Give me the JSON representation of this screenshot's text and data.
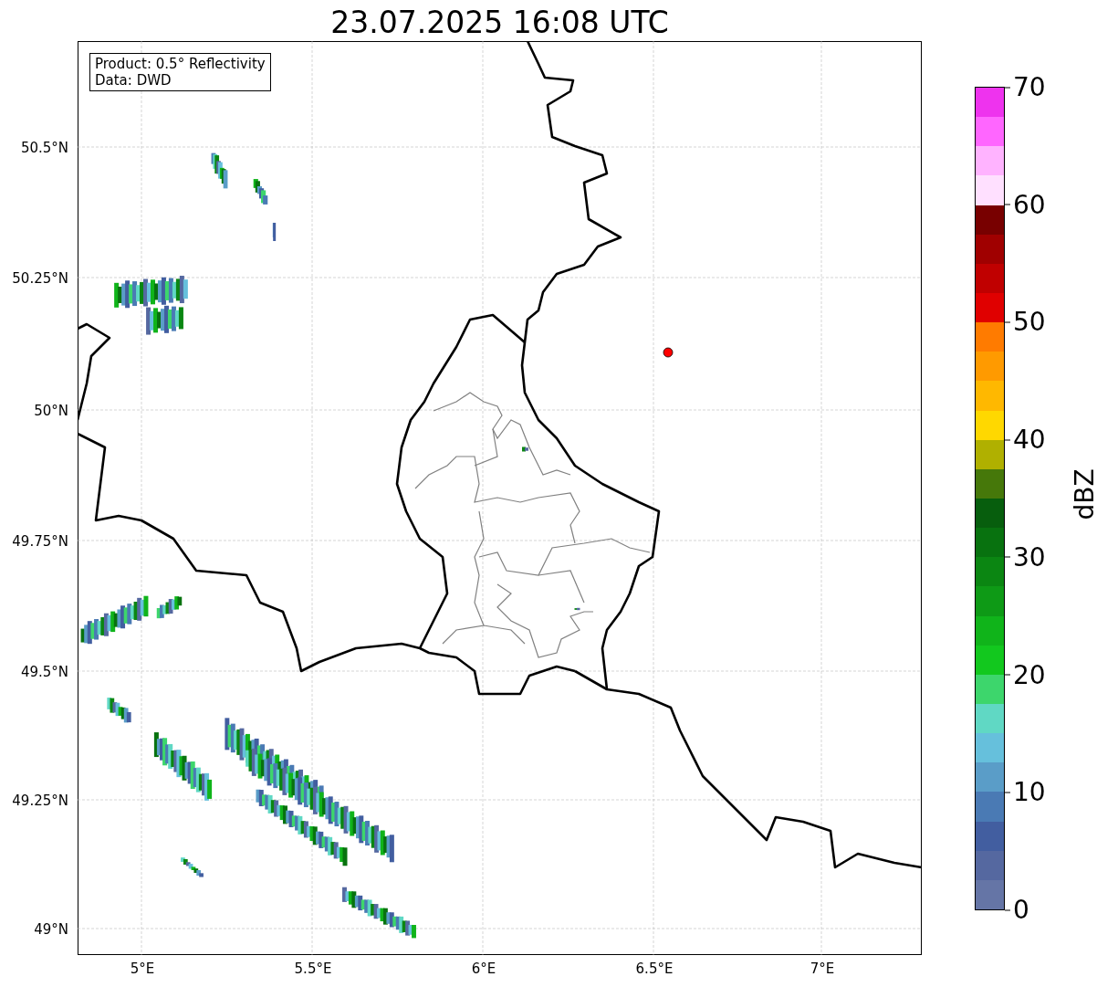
{
  "title": "23.07.2025 16:08 UTC",
  "info_box": [
    "Product: 0.5° Reflectivity",
    "Data: DWD"
  ],
  "map": {
    "xticks": [
      "5°E",
      "5.5°E",
      "6°E",
      "6.5°E",
      "7°E"
    ],
    "yticks": [
      "50.5°N",
      "50.25°N",
      "50°N",
      "49.75°N",
      "49.5°N",
      "49.25°N",
      "49°N"
    ]
  },
  "colorbar": {
    "label": "dBZ",
    "ticks": [
      "70",
      "60",
      "50",
      "40",
      "30",
      "20",
      "10",
      "0"
    ],
    "segments": [
      {
        "color": "#ee33ee"
      },
      {
        "color": "#ff66ff"
      },
      {
        "color": "#ffb3ff"
      },
      {
        "color": "#ffe0ff"
      },
      {
        "color": "#780000"
      },
      {
        "color": "#a00000"
      },
      {
        "color": "#c00000"
      },
      {
        "color": "#e00000"
      },
      {
        "color": "#ff7b00"
      },
      {
        "color": "#ff9a00"
      },
      {
        "color": "#ffb800"
      },
      {
        "color": "#ffd800"
      },
      {
        "color": "#b0b000"
      },
      {
        "color": "#46780a"
      },
      {
        "color": "#075e0d"
      },
      {
        "color": "#08720f"
      },
      {
        "color": "#0b8612"
      },
      {
        "color": "#0e9a16"
      },
      {
        "color": "#10b41a"
      },
      {
        "color": "#12c81e"
      },
      {
        "color": "#3dd66c"
      },
      {
        "color": "#60d8c4"
      },
      {
        "color": "#66c0dc"
      },
      {
        "color": "#5a9dc8"
      },
      {
        "color": "#4a7ab4"
      },
      {
        "color": "#425ea0"
      },
      {
        "color": "#5568a0"
      },
      {
        "color": "#6575a6"
      }
    ]
  }
}
